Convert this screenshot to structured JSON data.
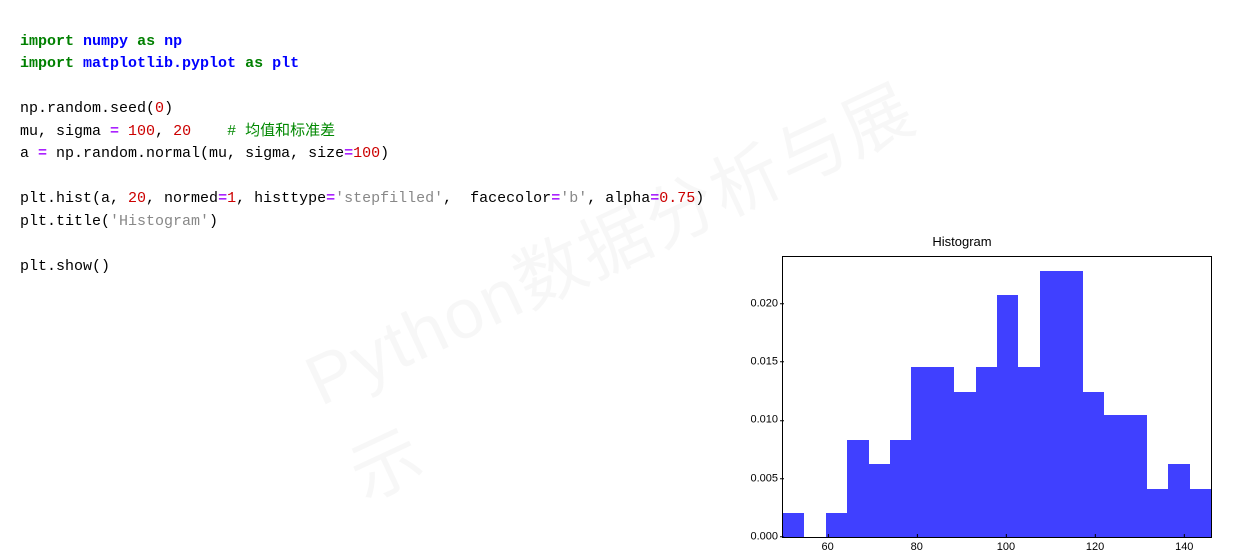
{
  "code": {
    "line1": {
      "kw1": "import",
      "mod1": "numpy",
      "kw2": "as",
      "alias1": "np"
    },
    "line2": {
      "kw1": "import",
      "mod1": "matplotlib.pyplot",
      "kw2": "as",
      "alias1": "plt"
    },
    "line4": {
      "expr": "np.random.seed",
      "arg": "0"
    },
    "line5": {
      "lhs": "mu, sigma ",
      "eq": "=",
      "n1": "100",
      "c1": ", ",
      "n2": "20",
      "cmt": "    # 均值和标准差"
    },
    "line6": {
      "lhs": "a ",
      "eq": "=",
      "fn": " np.random.normal(mu, sigma, size",
      "eq2": "=",
      "n": "100",
      "close": ")"
    },
    "line8": {
      "fn1": "plt.hist(a, ",
      "n1": "20",
      "arg1": ", normed",
      "eq1": "=",
      "n2": "1",
      "arg2": ", histtype",
      "eq2": "=",
      "s1": "'stepfilled'",
      "arg3": ",  facecolor",
      "eq3": "=",
      "s2": "'b'",
      "arg4": ", alpha",
      "eq4": "=",
      "n3": "0.75",
      "close": ")"
    },
    "line9": {
      "fn": "plt.title(",
      "s": "'Histogram'",
      "close": ")"
    },
    "line11": {
      "fn": "plt.show()"
    }
  },
  "watermark": "Python数据分析与展示",
  "chart_data": {
    "type": "bar",
    "title": "Histogram",
    "xlabel": "",
    "ylabel": "",
    "xlim": [
      50,
      146
    ],
    "ylim": [
      0,
      0.024
    ],
    "x_ticks": [
      60,
      80,
      100,
      120,
      140
    ],
    "y_ticks": [
      0.0,
      0.005,
      0.01,
      0.015,
      0.02
    ],
    "bin_edges": [
      50,
      54.8,
      59.6,
      64.4,
      69.2,
      74,
      78.8,
      83.6,
      88.4,
      93.2,
      98,
      102.8,
      107.6,
      112.4,
      117.2,
      122,
      126.8,
      131.6,
      136.4,
      141.2,
      146
    ],
    "values": [
      0.002,
      0.0,
      0.002,
      0.0083,
      0.0062,
      0.0083,
      0.0145,
      0.0145,
      0.0124,
      0.0145,
      0.0207,
      0.0145,
      0.0228,
      0.0228,
      0.0124,
      0.0104,
      0.0104,
      0.0041,
      0.0062,
      0.0041
    ]
  }
}
